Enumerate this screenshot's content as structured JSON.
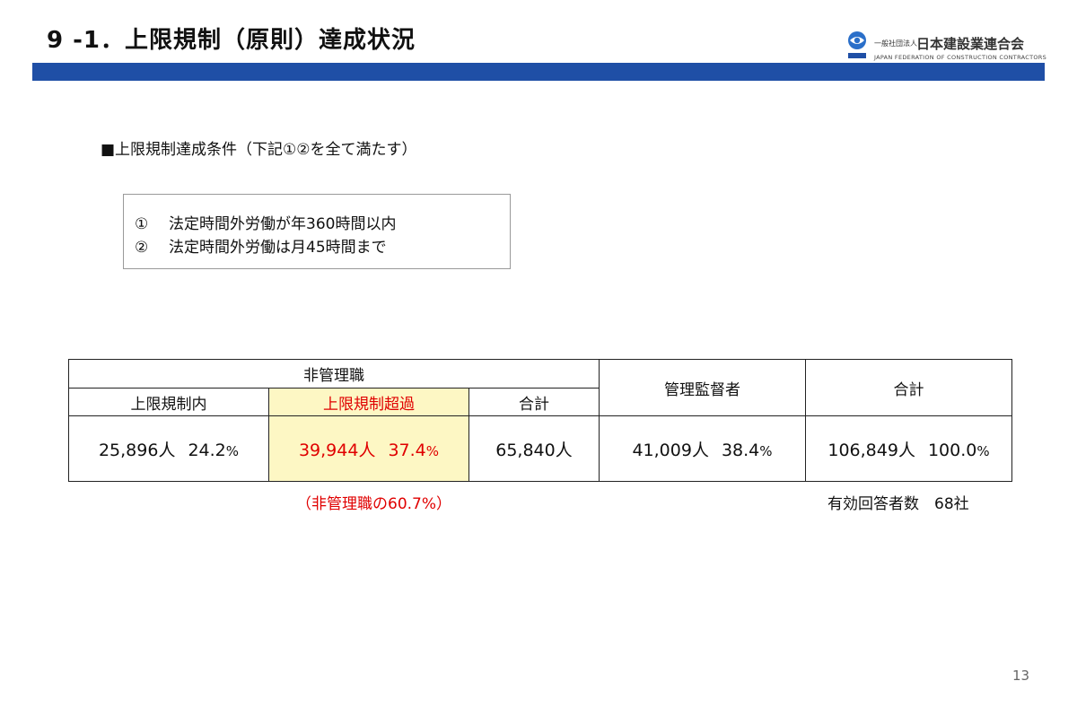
{
  "header": {
    "title": "9 -1．上限規制（原則）達成状況",
    "bar_color": "#1f4fa6"
  },
  "logo": {
    "small": "一般社団法人",
    "name": "日本建設業連合会",
    "english": "JAPAN FEDERATION OF CONSTRUCTION CONTRACTORS"
  },
  "conditions": {
    "heading": "■上限規制達成条件（下記①②を全て満たす）",
    "items": [
      {
        "num": "①",
        "text": "法定時間外労働が年360時間以内"
      },
      {
        "num": "②",
        "text": "法定時間外労働は月45時間まで"
      }
    ]
  },
  "table": {
    "group_header": "非管理職",
    "sub_headers": [
      "上限規制内",
      "上限規制超過",
      "合計"
    ],
    "manager_header": "管理監督者",
    "total_header": "合計",
    "cells": [
      {
        "count": "25,896人",
        "pct": "24.2",
        "pct_unit": "%"
      },
      {
        "count": "39,944人",
        "pct": "37.4",
        "pct_unit": "%"
      },
      {
        "count": "65,840人"
      },
      {
        "count": "41,009人",
        "pct": "38.4",
        "pct_unit": "%"
      },
      {
        "count": "106,849人",
        "pct": "100.0",
        "pct_unit": "%"
      }
    ],
    "highlight_color": "#fdf7c4",
    "alert_color": "#e00000"
  },
  "notes": {
    "ratio": "（非管理職の60.7%）",
    "respondents": "有効回答者数　68社"
  },
  "page_number": "13"
}
